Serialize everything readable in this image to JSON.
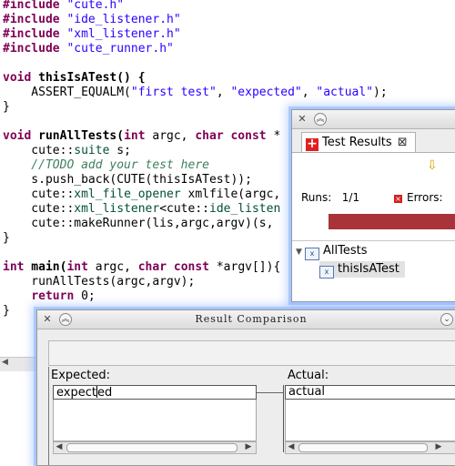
{
  "editor": {
    "includes": [
      {
        "directive": "#include",
        "file": "\"cute.h\""
      },
      {
        "directive": "#include",
        "file": "\"ide_listener.h\""
      },
      {
        "directive": "#include",
        "file": "\"xml_listener.h\""
      },
      {
        "directive": "#include",
        "file": "\"cute_runner.h\""
      }
    ],
    "test_fn": {
      "kw_void": "void",
      "signature": " thisIsATest() {",
      "assert_pre": "    ASSERT_EQUALM(",
      "arg1": "\"first test\"",
      "sep1": ", ",
      "arg2": "\"expected\"",
      "sep2": ", ",
      "arg3": "\"actual\"",
      "assert_post": ");",
      "close": "}"
    },
    "run_fn": {
      "kw_void": "void",
      "name": " runAllTests(",
      "kw_int": "int",
      "p1": " argc, ",
      "kw_char": "char",
      "sp": " ",
      "kw_const": "const",
      "p2": " *",
      "l1_pre": "    cute::",
      "l1_type": "suite",
      "l1_post": " s;",
      "comment": "    //TODO add your test here",
      "l3": "    s.push_back(CUTE(thisIsATest));",
      "l4_pre": "    cute::",
      "l4_type": "xml_file_opener",
      "l4_post": " xmlfile(argc,",
      "l5_pre": "    cute::",
      "l5_type": "xml_listener",
      "l5_mid": "<cute::",
      "l5_type2": "ide_listen",
      "l6": "    cute::makeRunner(lis,argc,argv)(s,",
      "close": "}"
    },
    "main_fn": {
      "kw_int": "int",
      "name": " main(",
      "kw_int2": "int",
      "p1": " argc, ",
      "kw_char": "char",
      "sp": " ",
      "kw_const": "const",
      "p2": " *argv[]){",
      "l1": "    runAllTests(argc,argv);",
      "l2_pre": "    ",
      "kw_return": "return",
      "l2_post": " 0;",
      "close": "}"
    }
  },
  "test_results": {
    "tab_label": "Test Results",
    "runs_label": "Runs:",
    "runs_value": "1/1",
    "errors_label": "Errors:",
    "progress_fraction": 1.0,
    "bar_color": "#a8343a",
    "tree": {
      "root": "AllTests",
      "child": "thisIsATest"
    }
  },
  "comparison": {
    "title": "Result Comparison",
    "expected_label": "Expected:",
    "actual_label": "Actual:",
    "expected_value": "expected",
    "actual_value": "actual"
  },
  "icons": [
    "close-cross-icon",
    "collapse-icon",
    "test-results-icon",
    "next-failure-icon",
    "previous-failure-icon",
    "error-icon",
    "test-suite-icon",
    "test-case-icon",
    "menu-dropdown-icon",
    "scroll-left-icon",
    "scroll-right-icon"
  ]
}
